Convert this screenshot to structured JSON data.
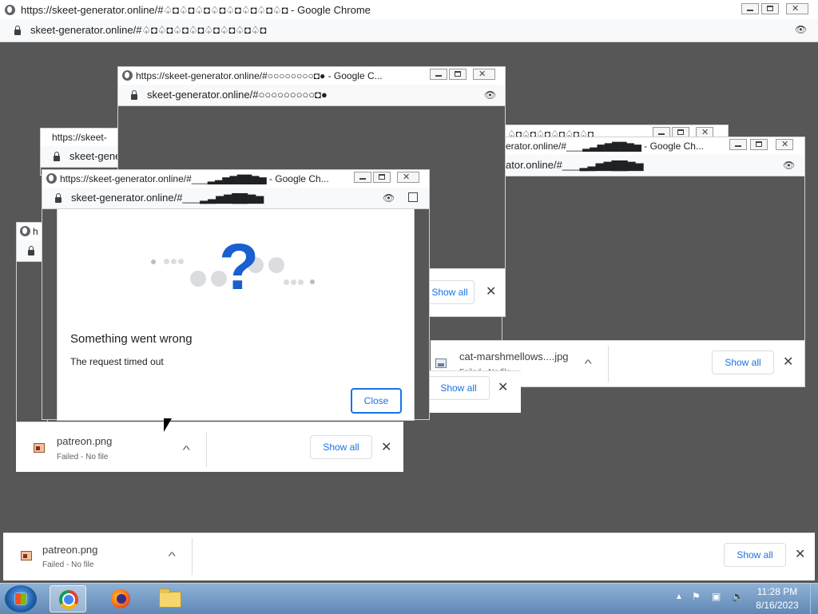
{
  "main_window": {
    "title": "https://skeet-generator.online/#♤◘♤◘♤◘♤◘♤◘♤◘♤◘♤◘ - Google Chrome",
    "url": "skeet-generator.online/#♤◘♤◘♤◘♤◘♤◘♤◘♤◘♤◘"
  },
  "win_back_left": {
    "title": "https://skeet-",
    "url": "skeet-gene",
    "title2": "h"
  },
  "win_top": {
    "title": "https://skeet-generator.online/#○○○○○○○○◘● - Google C...",
    "url": "skeet-generator.online/#○○○○○○○○○◘●"
  },
  "win_right": {
    "title": "♤◘♤◘♤◘♤◘♤◘♤◘",
    "title2": "erator.online/#___▂▃▅▆▇▇▆▅ - Google Ch...",
    "url": "ator.online/#___▂▃▅▆▇▇▆▅"
  },
  "win_front": {
    "title": "https://skeet-generator.online/#___▂▃▅▆▇▇▆▅ - Google Ch...",
    "url": "skeet-generator.online/#___▂▃▅▆▇▇▆▅"
  },
  "dialog": {
    "title": "Something went wrong",
    "message": "The request timed out",
    "close_label": "Close"
  },
  "downloads": {
    "show_all": "Show all",
    "failed_status": "Failed - No file",
    "front_file": "patreon.png",
    "right_file": "cat-marshmellows....jpg",
    "main_file": "patreon.png",
    "top_show_all": "Show all",
    "mid_show_all": "Show all"
  },
  "taskbar": {
    "time": "11:28 PM",
    "date": "8/16/2023",
    "apps": [
      "chrome-icon",
      "firefox-icon",
      "file-explorer-icon"
    ]
  },
  "colors": {
    "desktop_gray": "#575757",
    "accent_blue": "#1a73e8",
    "taskbar": "#5f88b5"
  }
}
